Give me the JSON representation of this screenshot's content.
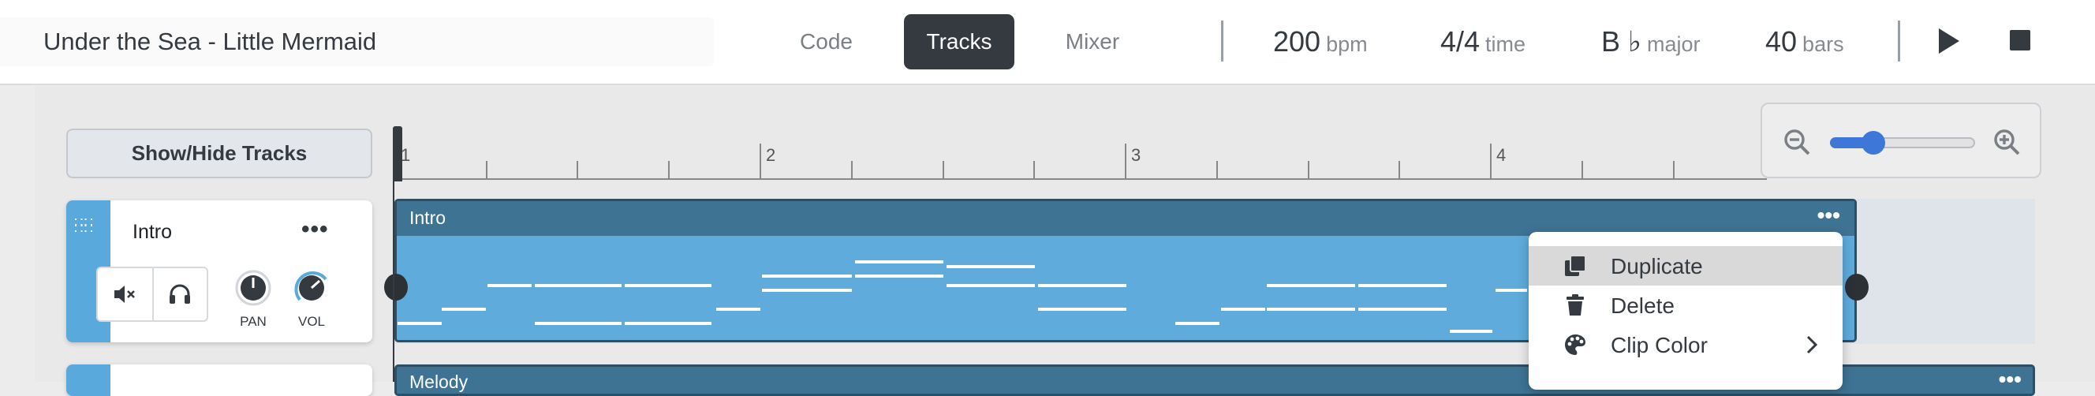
{
  "header": {
    "song_title": "Under the Sea - Little Mermaid",
    "tabs": [
      {
        "label": "Code",
        "active": false
      },
      {
        "label": "Tracks",
        "active": true
      },
      {
        "label": "Mixer",
        "active": false
      }
    ],
    "tempo": {
      "value": "200",
      "unit": "bpm"
    },
    "time_signature": {
      "value": "4/4",
      "unit": "time"
    },
    "key": {
      "value": "B ♭",
      "unit": "major"
    },
    "length": {
      "value": "40",
      "unit": "bars"
    },
    "icons": {
      "play": "play-icon",
      "stop": "stop-icon"
    }
  },
  "sidebar": {
    "show_hide_label": "Show/Hide Tracks",
    "tracks": [
      {
        "name": "Intro",
        "menu": "•••",
        "buttons": {
          "mute": "mute-icon",
          "solo": "headphones-icon"
        },
        "knobs": [
          {
            "label": "PAN"
          },
          {
            "label": "VOL"
          }
        ]
      }
    ]
  },
  "timeline": {
    "bar_numbers": [
      "1",
      "2",
      "3",
      "4"
    ],
    "clips": [
      {
        "name": "Intro",
        "menu": "•••",
        "color": "#5fabdb",
        "header_color": "#3e7394"
      },
      {
        "name": "Melody",
        "menu": "•••"
      }
    ]
  },
  "zoom": {
    "level": 0.22,
    "out_icon": "zoom-out-icon",
    "in_icon": "zoom-in-icon"
  },
  "context_menu": {
    "items": [
      {
        "label": "Duplicate",
        "icon": "duplicate-icon",
        "highlighted": true
      },
      {
        "label": "Delete",
        "icon": "trash-icon",
        "highlighted": false
      },
      {
        "label": "Clip Color",
        "icon": "palette-icon",
        "highlighted": false,
        "submenu": true
      }
    ]
  },
  "colors": {
    "accent": "#3d78d8",
    "track_color": "#5aa9dc",
    "dark": "#343a40"
  }
}
